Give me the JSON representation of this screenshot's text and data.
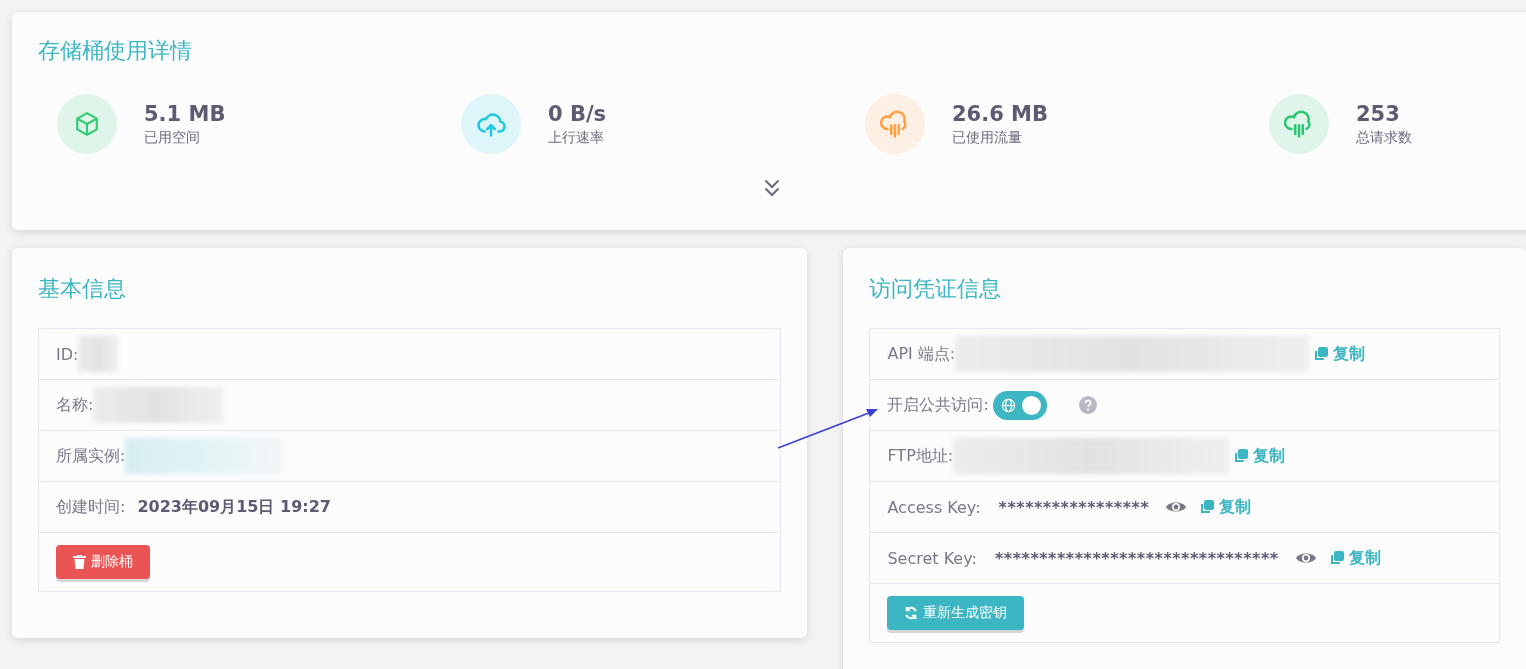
{
  "usage": {
    "title": "存储桶使用详情",
    "stats": [
      {
        "value": "5.1 MB",
        "label": "已用空间",
        "kind": "box",
        "color": "#2ecc71"
      },
      {
        "value": "0 B/s",
        "label": "上行速率",
        "kind": "upload",
        "color": "#1cc7e0"
      },
      {
        "value": "26.6 MB",
        "label": "已使用流量",
        "kind": "rain",
        "color": "#ff9f43"
      },
      {
        "value": "253",
        "label": "总请求数",
        "kind": "rain",
        "color": "#28c76f"
      }
    ]
  },
  "basic": {
    "title": "基本信息",
    "rows": [
      {
        "label": "ID:",
        "kind": "redacted"
      },
      {
        "label": "名称:",
        "kind": "redacted"
      },
      {
        "label": "所属实例:",
        "kind": "redacted_link"
      },
      {
        "label": "创建时间:",
        "kind": "text",
        "value": "2023年09月15日 19:27"
      }
    ],
    "delete_button": "删除桶"
  },
  "credentials": {
    "title": "访问凭证信息",
    "rows": [
      {
        "kind": "copy",
        "label": "API 端点:",
        "copy": "复制"
      },
      {
        "kind": "toggle",
        "label": "开启公共访问:",
        "on": true
      },
      {
        "kind": "copy",
        "label": "FTP地址:",
        "copy": "复制"
      },
      {
        "kind": "key",
        "label": "Access Key:",
        "value": "*****************",
        "copy": "复制"
      },
      {
        "kind": "key",
        "label": "Secret Key:",
        "value": "********************************",
        "copy": "复制"
      }
    ],
    "regenerate_button": "重新生成密钥"
  }
}
